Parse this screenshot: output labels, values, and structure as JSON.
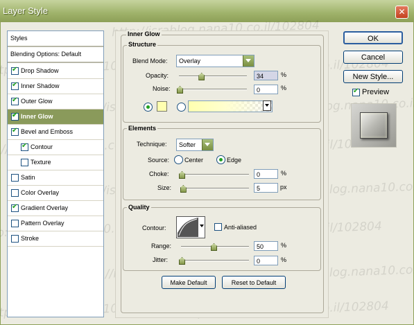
{
  "window": {
    "title": "Layer Style"
  },
  "watermark": "http://israblog.nana10.co.il/102804",
  "sidebar": {
    "items": [
      {
        "label": "Styles",
        "checked": null
      },
      {
        "label": "Blending Options: Default",
        "checked": null
      },
      {
        "label": "Drop Shadow",
        "checked": true
      },
      {
        "label": "Inner Shadow",
        "checked": true
      },
      {
        "label": "Outer Glow",
        "checked": true
      },
      {
        "label": "Inner Glow",
        "checked": true,
        "selected": true
      },
      {
        "label": "Bevel and Emboss",
        "checked": true
      },
      {
        "label": "Contour",
        "checked": true
      },
      {
        "label": "Texture",
        "checked": false
      },
      {
        "label": "Satin",
        "checked": false
      },
      {
        "label": "Color Overlay",
        "checked": false
      },
      {
        "label": "Gradient Overlay",
        "checked": true
      },
      {
        "label": "Pattern Overlay",
        "checked": false
      },
      {
        "label": "Stroke",
        "checked": false
      }
    ]
  },
  "panel": {
    "title": "Inner Glow",
    "structure": {
      "legend": "Structure",
      "blend_mode_label": "Blend Mode:",
      "blend_mode_value": "Overlay",
      "opacity_label": "Opacity:",
      "opacity_value": "34",
      "opacity_fraction": 0.34,
      "noise_label": "Noise:",
      "noise_value": "0",
      "noise_fraction": 0,
      "percent": "%",
      "color": "#ffffb0",
      "gradient_start": "#ffffb0"
    },
    "elements": {
      "legend": "Elements",
      "technique_label": "Technique:",
      "technique_value": "Softer",
      "source_label": "Source:",
      "source_center": "Center",
      "source_edge": "Edge",
      "choke_label": "Choke:",
      "choke_value": "0",
      "choke_fraction": 0,
      "size_label": "Size:",
      "size_value": "5",
      "size_fraction": 0.02,
      "percent": "%",
      "px": "px"
    },
    "quality": {
      "legend": "Quality",
      "contour_label": "Contour:",
      "anti_aliased_label": "Anti-aliased",
      "anti_aliased": false,
      "range_label": "Range:",
      "range_value": "50",
      "range_fraction": 0.5,
      "jitter_label": "Jitter:",
      "jitter_value": "0",
      "jitter_fraction": 0,
      "percent": "%"
    },
    "buttons": {
      "make_default": "Make Default",
      "reset_default": "Reset to Default"
    }
  },
  "right": {
    "ok": "OK",
    "cancel": "Cancel",
    "new_style": "New Style...",
    "preview_label": "Preview",
    "preview_checked": true
  },
  "colors": {
    "accent": "#8a9a5b",
    "titlebar": "#9fb26a",
    "close": "#c4411f"
  }
}
